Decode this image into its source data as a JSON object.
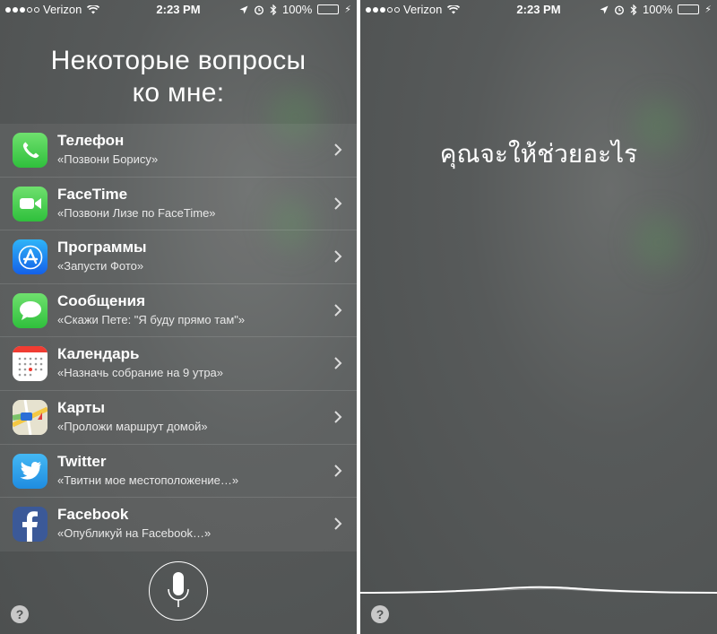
{
  "status": {
    "carrier": "Verizon",
    "time": "2:23 PM",
    "battery": "100%",
    "battery_level": 1.0
  },
  "left": {
    "title_line1": "Некоторые вопросы",
    "title_line2": "ко мне:",
    "items": [
      {
        "name": "Телефон",
        "hint": "«Позвони Борису»",
        "icon": "phone-icon"
      },
      {
        "name": "FaceTime",
        "hint": "«Позвони Лизе по FaceTime»",
        "icon": "facetime-icon"
      },
      {
        "name": "Программы",
        "hint": "«Запусти Фото»",
        "icon": "app-store-icon"
      },
      {
        "name": "Сообщения",
        "hint": "«Скажи Пете: \"Я буду прямо там\"»",
        "icon": "messages-icon"
      },
      {
        "name": "Календарь",
        "hint": "«Назначь собрание на 9 утра»",
        "icon": "calendar-icon"
      },
      {
        "name": "Карты",
        "hint": "«Проложи маршрут домой»",
        "icon": "maps-icon"
      },
      {
        "name": "Twitter",
        "hint": "«Твитни мое местоположение…»",
        "icon": "twitter-icon"
      },
      {
        "name": "Facebook",
        "hint": "«Опубликуй на Facebook…»",
        "icon": "facebook-icon"
      }
    ],
    "help": "?"
  },
  "right": {
    "prompt": "คุณจะให้ช่วยอะไร",
    "help": "?"
  },
  "colors": {
    "phone": "#4cd964",
    "facetime": "#4cd964",
    "appstore": "#1e7cf2",
    "messages": "#4cd964",
    "calendar": "#ffffff",
    "twitter": "#1da1f2",
    "facebook": "#3b5998",
    "battery": "#4cd964"
  }
}
